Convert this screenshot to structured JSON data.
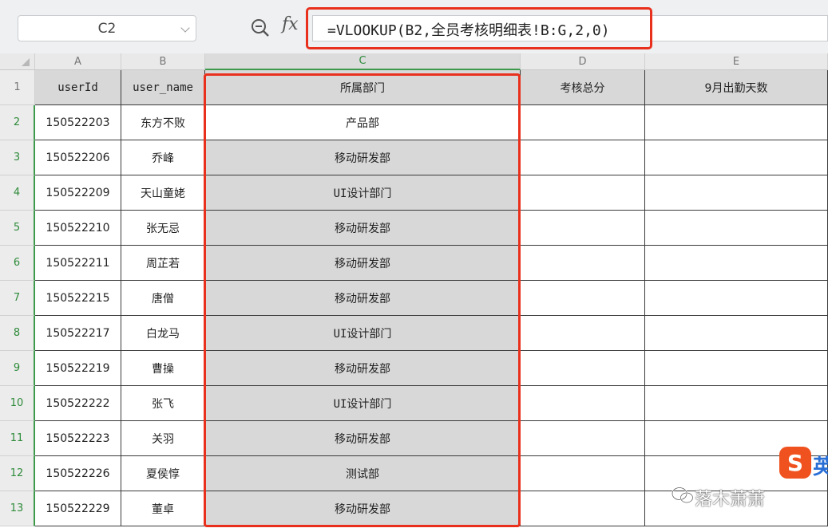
{
  "formula_bar": {
    "name_box": "C2",
    "fx_label": "fx",
    "formula": "=VLOOKUP(B2,全员考核明细表!B:G,2,0)"
  },
  "sheet": {
    "columns": [
      "A",
      "B",
      "C",
      "D",
      "E"
    ],
    "active_column": "C",
    "headers": [
      "userId",
      "user_name",
      "所属部门",
      "考核总分",
      "9月出勤天数"
    ],
    "row_numbers": [
      "1",
      "2",
      "3",
      "4",
      "5",
      "6",
      "7",
      "8",
      "9",
      "10",
      "11",
      "12",
      "13"
    ],
    "rows": [
      {
        "userId": "150522203",
        "user_name": "东方不败",
        "dept": "产品部",
        "score": "",
        "days": ""
      },
      {
        "userId": "150522206",
        "user_name": "乔峰",
        "dept": "移动研发部",
        "score": "",
        "days": ""
      },
      {
        "userId": "150522209",
        "user_name": "天山童姥",
        "dept": "UI设计部门",
        "score": "",
        "days": ""
      },
      {
        "userId": "150522210",
        "user_name": "张无忌",
        "dept": "移动研发部",
        "score": "",
        "days": ""
      },
      {
        "userId": "150522211",
        "user_name": "周芷若",
        "dept": "移动研发部",
        "score": "",
        "days": ""
      },
      {
        "userId": "150522215",
        "user_name": "唐僧",
        "dept": "移动研发部",
        "score": "",
        "days": ""
      },
      {
        "userId": "150522217",
        "user_name": "白龙马",
        "dept": "UI设计部门",
        "score": "",
        "days": ""
      },
      {
        "userId": "150522219",
        "user_name": "曹操",
        "dept": "移动研发部",
        "score": "",
        "days": ""
      },
      {
        "userId": "150522222",
        "user_name": "张飞",
        "dept": "UI设计部门",
        "score": "",
        "days": ""
      },
      {
        "userId": "150522223",
        "user_name": "关羽",
        "dept": "移动研发部",
        "score": "",
        "days": ""
      },
      {
        "userId": "150522226",
        "user_name": "夏侯惇",
        "dept": "测试部",
        "score": "",
        "days": ""
      },
      {
        "userId": "150522229",
        "user_name": "董卓",
        "dept": "移动研发部",
        "score": "",
        "days": ""
      }
    ]
  },
  "watermark": {
    "ime_logo": "S",
    "ime_text": "英",
    "account": "落木萧萧"
  },
  "colors": {
    "highlight": "#e8301c",
    "selection": "#3c9a4a",
    "selected_fill": "#d8d8d8"
  }
}
